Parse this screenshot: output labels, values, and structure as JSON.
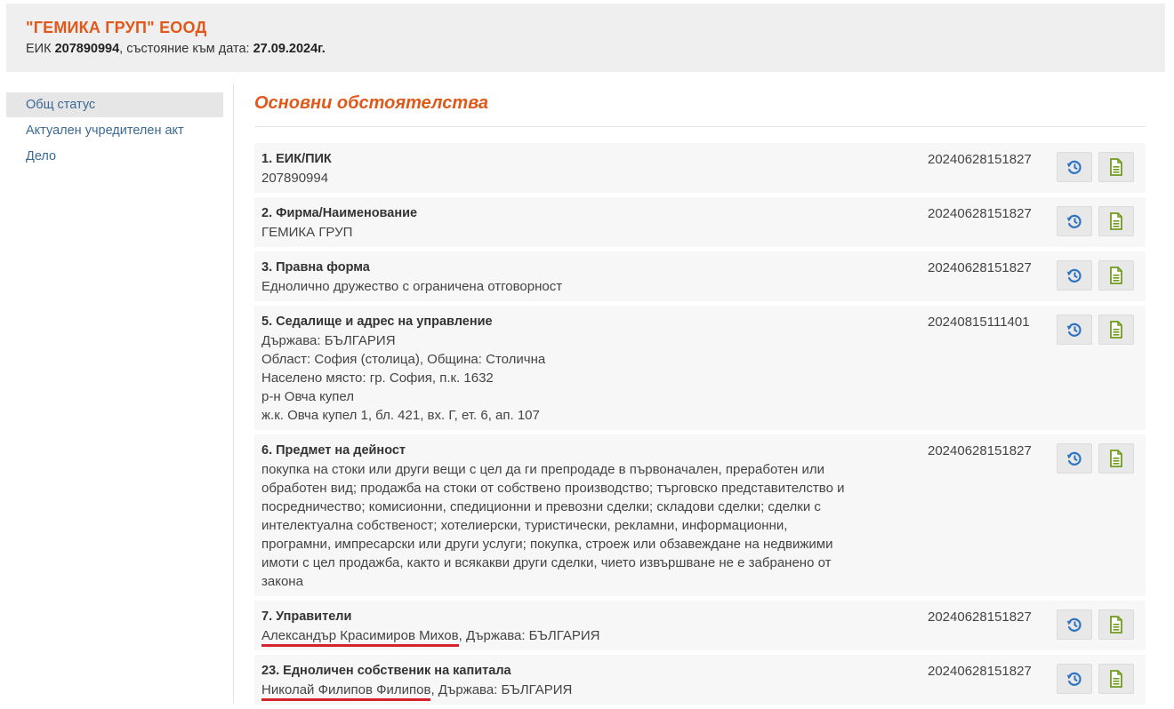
{
  "header": {
    "company": "\"ГЕМИКА ГРУП\" ЕООД",
    "eik_label": "ЕИК",
    "eik": "207890994",
    "status_label": ", състояние към дата:",
    "status_date": "27.09.2024г."
  },
  "sidebar": {
    "items": [
      {
        "label": "Общ статус"
      },
      {
        "label": "Актуален учредителен акт"
      },
      {
        "label": "Дело"
      }
    ]
  },
  "main": {
    "section_title": "Основни обстоятелства",
    "rows": [
      {
        "title": "1. ЕИК/ПИК",
        "lines": [
          "207890994"
        ],
        "date": "20240628151827"
      },
      {
        "title": "2. Фирма/Наименование",
        "lines": [
          "ГЕМИКА ГРУП"
        ],
        "date": "20240628151827"
      },
      {
        "title": "3. Правна форма",
        "lines": [
          "Еднолично дружество с ограничена отговорност"
        ],
        "date": "20240628151827"
      },
      {
        "title": "5. Седалище и адрес на управление",
        "lines": [
          "Държава: БЪЛГАРИЯ",
          "Област: София (столица), Община: Столична",
          "Населено място: гр. София, п.к. 1632",
          "р-н Овча купел",
          "ж.к. Овча купел 1, бл. 421, вх. Г, ет. 6, ап. 107"
        ],
        "date": "20240815111401"
      },
      {
        "title": "6. Предмет на дейност",
        "lines": [
          "покупка на стоки или други вещи с цел да ги препродаде в първоначален, преработен или",
          "обработен вид; продажба на стоки от собствено производство; търговско представителство и",
          "посредничество; комисионни, спедиционни и превозни сделки; складови сделки; сделки с",
          "интелектуална собственост; хотелиерски, туристически, рекламни, информационни,",
          "програмни, импресарски или други услуги; покупка, строеж или обзавеждане на недвижими",
          "имоти с цел продажба, както и всякакви други сделки, чието извършване не е забранено от",
          "закона"
        ],
        "date": "20240628151827"
      },
      {
        "title": "7. Управители",
        "person": "Александър Красимиров Михов",
        "rest": ", Държава: БЪЛГАРИЯ",
        "date": "20240628151827"
      },
      {
        "title": "23. Едноличен собственик на капитала",
        "person": "Николай Филипов Филипов",
        "rest": ", Държава: БЪЛГАРИЯ",
        "date": "20240628151827"
      }
    ]
  },
  "icons": {
    "history": "history-icon",
    "document": "document-icon"
  },
  "colors": {
    "accent": "#e0591a",
    "link": "#3c6a95",
    "history_icon": "#2f74c0",
    "doc_icon": "#6f9a1e",
    "underline": "#d4232b"
  }
}
